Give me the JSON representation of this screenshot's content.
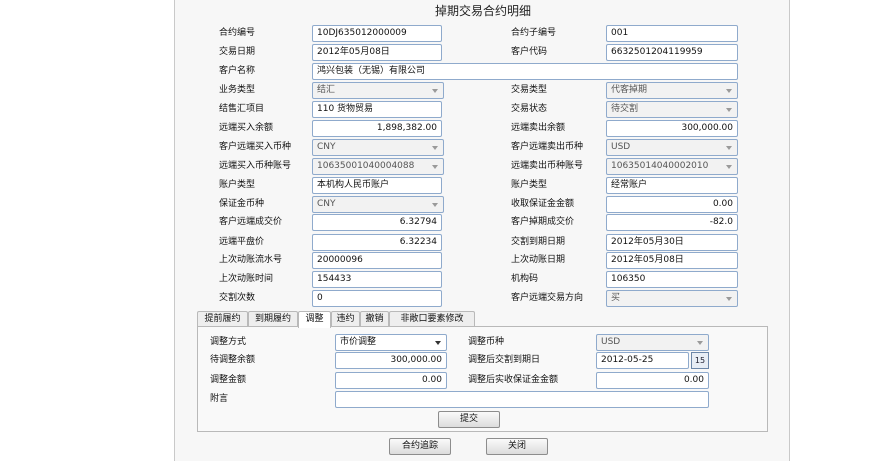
{
  "title": "掉期交易合约明细",
  "form": [
    {
      "l_label": "合约编号",
      "l_value": "10DJ635012000009",
      "r_label": "合约子编号",
      "r_value": "001"
    },
    {
      "l_label": "交易日期",
      "l_value": "2012年05月08日",
      "r_label": "客户代码",
      "r_value": "6632501204119959"
    },
    {
      "l_label": "客户名称",
      "l_value": "鸿兴包装（无锡）有限公司"
    },
    {
      "l_label": "业务类型",
      "l_value": "结汇",
      "r_label": "交易类型",
      "r_value": "代客掉期"
    },
    {
      "l_label": "结售汇项目",
      "l_value": "110  货物贸易",
      "r_label": "交易状态",
      "r_value": "待交割"
    },
    {
      "l_label": "远端买入余额",
      "l_value": "1,898,382.00",
      "r_label": "远端卖出余额",
      "r_value": "300,000.00"
    },
    {
      "l_label": "客户远端买入币种",
      "l_value": "CNY",
      "r_label": "客户远端卖出币种",
      "r_value": "USD"
    },
    {
      "l_label": "远端买入币种账号",
      "l_value": "10635001040004088",
      "r_label": "远端卖出币种账号",
      "r_value": "10635014040002010"
    },
    {
      "l_label": "账户类型",
      "l_value": "本机构人民币账户",
      "r_label": "账户类型",
      "r_value": "经常账户"
    },
    {
      "l_label": "保证金币种",
      "l_value": "CNY",
      "r_label": "收取保证金金额",
      "r_value": "0.00"
    },
    {
      "l_label": "客户远端成交价",
      "l_value": "6.32794",
      "r_label": "客户掉期成交价",
      "r_value": "-82.0"
    },
    {
      "l_label": "远端平盘价",
      "l_value": "6.32234",
      "r_label": "交割到期日期",
      "r_value": "2012年05月30日"
    },
    {
      "l_label": "上次动账流水号",
      "l_value": "20000096",
      "r_label": "上次动账日期",
      "r_value": "2012年05月08日"
    },
    {
      "l_label": "上次动账时间",
      "l_value": "154433",
      "r_label": "机构码",
      "r_value": "106350"
    },
    {
      "l_label": "交割次数",
      "l_value": "0",
      "r_label": "客户远端交易方向",
      "r_value": "买"
    }
  ],
  "tabs": [
    "提前履约",
    "到期履约",
    "调整",
    "违约",
    "撤销",
    "非敞口要素修改"
  ],
  "adjust": {
    "method_label": "调整方式",
    "method_value": "市价调整",
    "currency_label": "调整币种",
    "currency_value": "USD",
    "pending_label": "待调整余额",
    "pending_value": "300,000.00",
    "new_date_label": "调整后交割到期日",
    "new_date_value": "2012-05-25",
    "calendar_glyph": "15",
    "amount_label": "调整金额",
    "amount_value": "0.00",
    "margin_label": "调整后实收保证金金额",
    "margin_value": "0.00",
    "note_label": "附言",
    "note_value": "",
    "submit_label": "提交"
  },
  "footer": {
    "trace_label": "合约追踪",
    "close_label": "关闭"
  }
}
